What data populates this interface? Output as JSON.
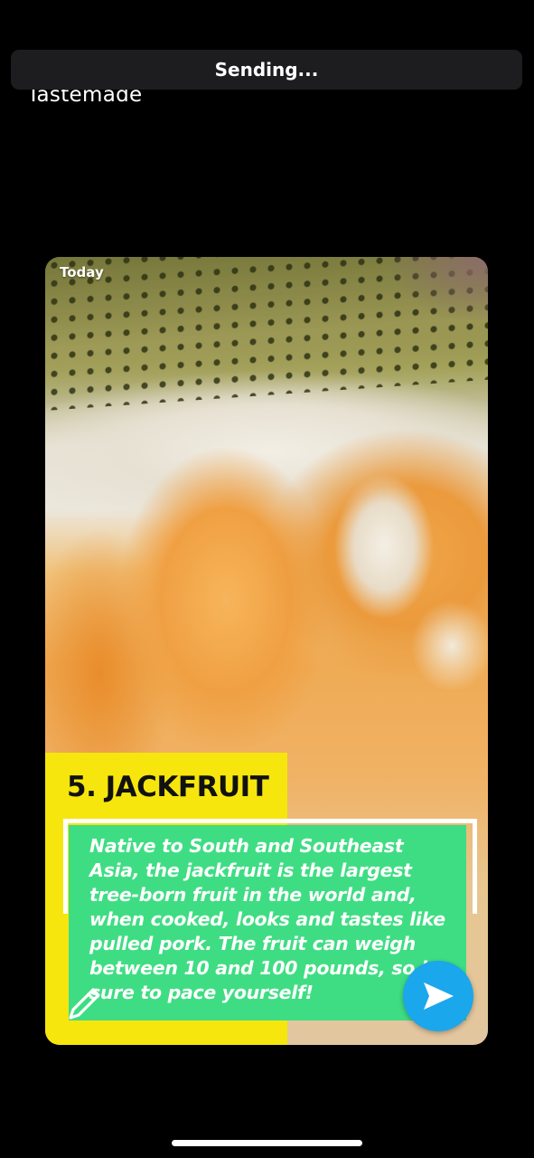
{
  "status": {
    "sending_text": "Sending..."
  },
  "source": {
    "name": "Tastemade"
  },
  "card": {
    "timestamp": "Today",
    "headline": "5. JACKFRUIT",
    "description": "Native to South and Southeast Asia, the jackfruit is the largest tree-born fruit in the world and, when cooked, looks and tastes like pulled pork. The fruit can weigh between 10 and 100 pounds, so be sure to pace yourself!"
  },
  "icons": {
    "edit": "pencil-icon",
    "send": "send-arrow-icon"
  },
  "colors": {
    "background": "#000000",
    "sending_bar": "#1d1d1f",
    "headline_panel": "#f6e60d",
    "text_box": "#3fdd83",
    "send_button": "#1aa7ec"
  }
}
